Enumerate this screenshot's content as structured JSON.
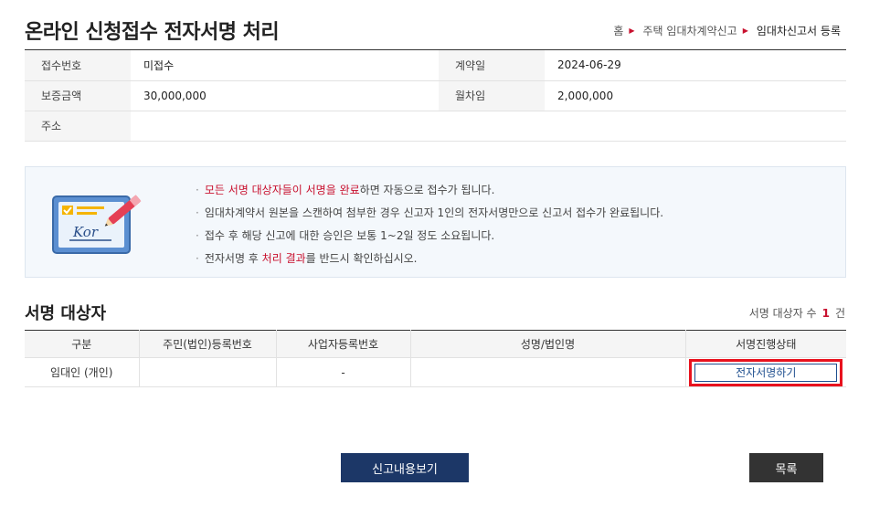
{
  "header": {
    "title": "온라인 신청접수 전자서명 처리",
    "breadcrumb": [
      "홈",
      "주택 임대차계약신고",
      "임대차신고서 등록"
    ]
  },
  "info": {
    "receipt_no_label": "접수번호",
    "receipt_no_value": "미접수",
    "contract_date_label": "계약일",
    "contract_date_value": "2024-06-29",
    "deposit_label": "보증금액",
    "deposit_value": "30,000,000",
    "rent_label": "월차임",
    "rent_value": "2,000,000",
    "address_label": "주소",
    "address_value": ""
  },
  "notice": {
    "illustration_text": "Kor",
    "item1_highlight": "모든 서명 대상자들이 서명을 완료",
    "item1_rest": "하면 자동으로 접수가 됩니다.",
    "item2": "임대차계약서 원본을 스캔하여 첨부한 경우 신고자 1인의 전자서명만으로 신고서 접수가 완료됩니다.",
    "item3": "접수 후 해당 신고에 대한 승인은 보통 1~2일 정도 소요됩니다.",
    "item4_pre": "전자서명 후 ",
    "item4_highlight": "처리 결과",
    "item4_post": "를 반드시 확인하십시오."
  },
  "signers": {
    "title": "서명 대상자",
    "count_label": "서명 대상자 수",
    "count": "1",
    "count_unit": "건",
    "columns": [
      "구분",
      "주민(법인)등록번호",
      "사업자등록번호",
      "성명/법인명",
      "서명진행상태"
    ],
    "rows": [
      {
        "type": "임대인 (개인)",
        "rrn": "",
        "brn": "-",
        "name": "",
        "action": "전자서명하기"
      }
    ]
  },
  "buttons": {
    "view": "신고내용보기",
    "list": "목록"
  },
  "colors": {
    "accent_red": "#c8102e",
    "navy": "#1c3767",
    "highlight_box": "#e8121e"
  }
}
